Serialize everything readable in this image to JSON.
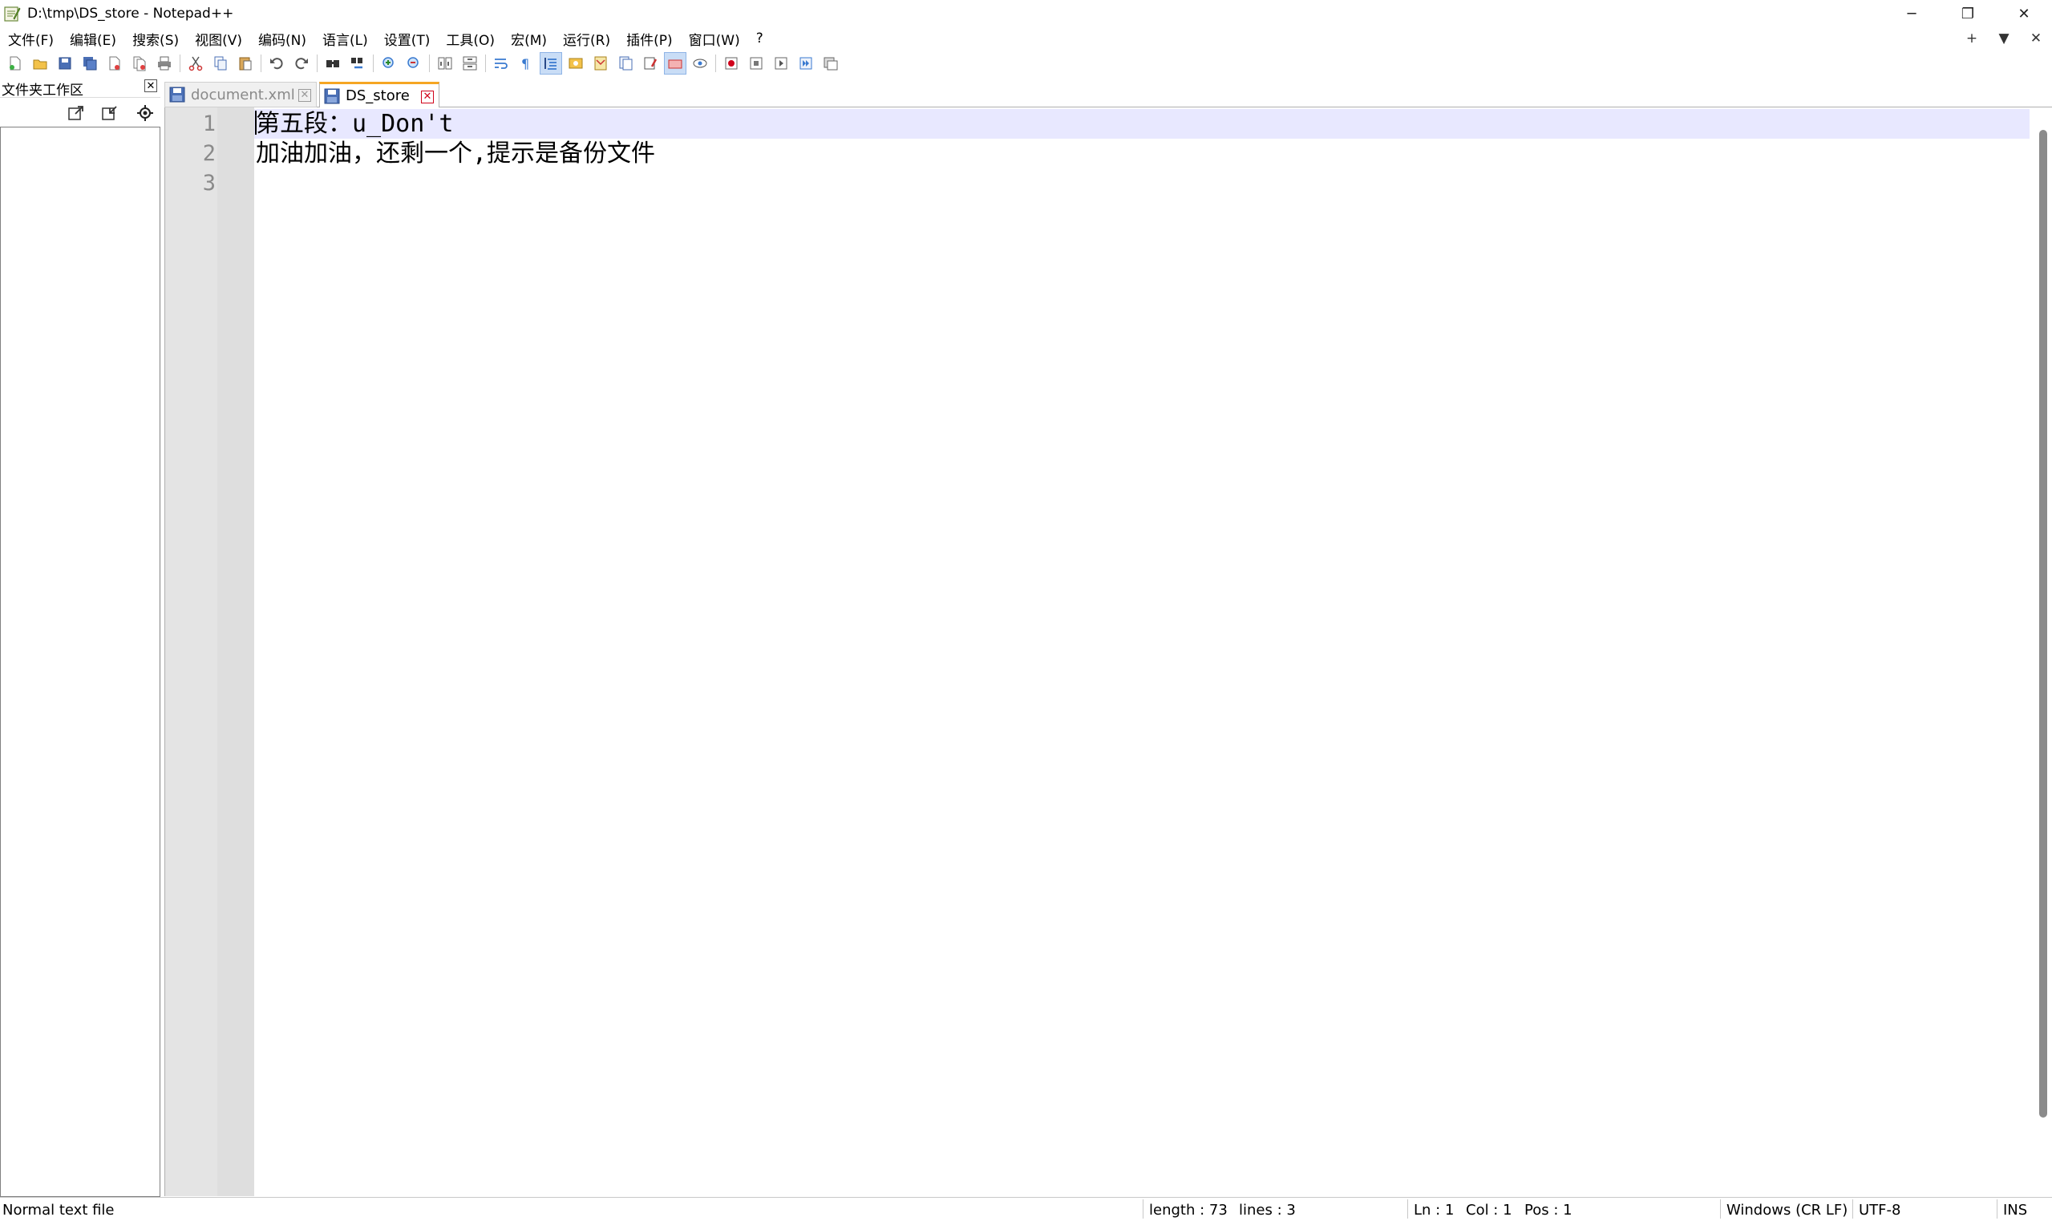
{
  "window": {
    "title": "D:\\tmp\\DS_store - Notepad++",
    "minimize": "─",
    "restore": "❐",
    "close": "✕"
  },
  "menu": {
    "items": [
      "文件(F)",
      "编辑(E)",
      "搜索(S)",
      "视图(V)",
      "编码(N)",
      "语言(L)",
      "设置(T)",
      "工具(O)",
      "宏(M)",
      "运行(R)",
      "插件(P)",
      "窗口(W)",
      "?"
    ],
    "right": [
      "+",
      "▼",
      "✕"
    ]
  },
  "toolbar": {
    "icons": [
      "new-file-icon",
      "open-file-icon",
      "save-icon",
      "save-all-icon",
      "close-icon",
      "close-all-icon",
      "print-icon",
      "cut-icon",
      "copy-icon",
      "paste-icon",
      "undo-icon",
      "redo-icon",
      "find-icon",
      "replace-icon",
      "zoom-in-icon",
      "zoom-out-icon",
      "sync-vertical-icon",
      "sync-horizontal-icon",
      "word-wrap-icon",
      "show-all-chars-icon",
      "indent-guide-icon",
      "define-language-icon",
      "document-map-icon",
      "function-list-icon",
      "folder-workspace-icon",
      "monitoring-icon",
      "record-macro-icon",
      "stop-record-icon",
      "play-macro-icon",
      "run-macro-multiple-icon",
      "save-macro-icon"
    ]
  },
  "panel": {
    "title": "文件夹工作区",
    "close": "✕"
  },
  "tabs": [
    {
      "label": "document.xml",
      "active": false,
      "close": "✕"
    },
    {
      "label": "DS_store",
      "active": true,
      "close": "✕"
    }
  ],
  "editor": {
    "lines": [
      {
        "number": "1",
        "text": "第五段：u_Don't"
      },
      {
        "number": "2",
        "text": "加油加油，还剩一个,提示是备份文件"
      },
      {
        "number": "3",
        "text": ""
      }
    ],
    "current_line_color": "#e8e8ff"
  },
  "status": {
    "file_type": "Normal text file",
    "length": "length : 73",
    "lines": "lines : 3",
    "ln": "Ln : 1",
    "col": "Col : 1",
    "pos": "Pos : 1",
    "eol": "Windows (CR LF)",
    "encoding": "UTF-8",
    "mode": "INS"
  },
  "colors": {
    "active_tab_accent": "#f5a623",
    "tab_close_active": "#d0021b"
  }
}
